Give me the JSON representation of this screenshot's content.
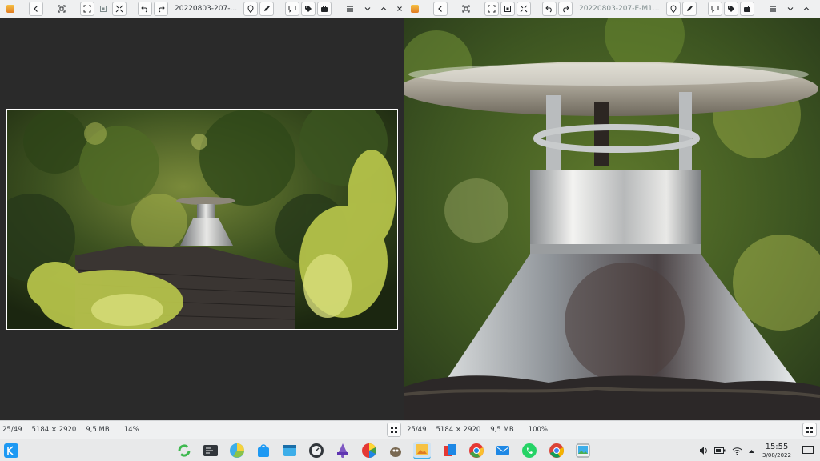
{
  "left_window": {
    "title": "20220803-207-...",
    "status": {
      "position": "25/49",
      "dimensions": "5184 × 2920",
      "file_size": "9,5 MB",
      "zoom": "14%"
    }
  },
  "right_window": {
    "title": "20220803-207-E-M1...",
    "status": {
      "position": "25/49",
      "dimensions": "5184 × 2920",
      "file_size": "9,5 MB",
      "zoom": "100%"
    }
  },
  "taskbar": {
    "clock_time": "15:55",
    "clock_date": "3/08/2022",
    "apps": [
      "kde-launcher-icon",
      "refresh-app-icon",
      "terminal-icon",
      "pie-chart-app-icon",
      "store-bag-icon",
      "window-icon",
      "dial-icon",
      "wizard-icon",
      "color-wheel-icon",
      "gimp-icon",
      "image-viewer-icon",
      "presentation-icon",
      "chromium-icon",
      "mail-icon",
      "whatsapp-icon",
      "chrome-icon",
      "photo-app-icon"
    ],
    "tray": [
      "volume-icon",
      "battery-icon",
      "wifi-icon",
      "tray-expand-icon",
      "desktop-icon"
    ]
  },
  "colors": {
    "accent": "#3daee9",
    "toolbar_bg": "#eff0f1",
    "viewer_bg": "#2a2a2a"
  }
}
